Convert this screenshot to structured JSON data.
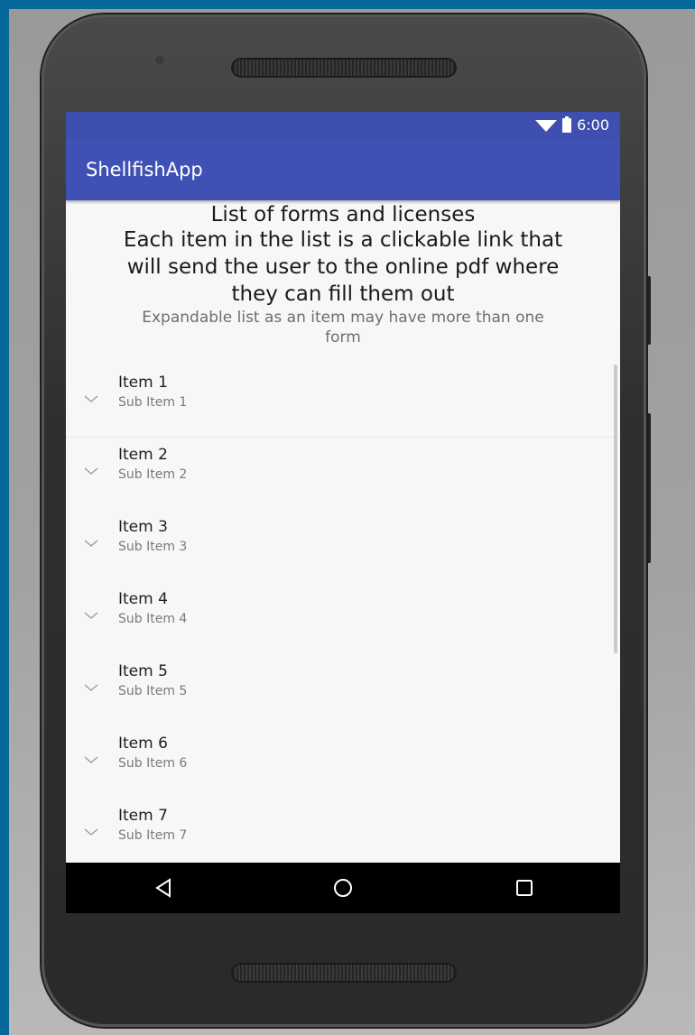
{
  "status": {
    "time": "6:00",
    "icons": [
      "wifi-icon",
      "battery-icon"
    ]
  },
  "app": {
    "title": "ShellfishApp"
  },
  "header": {
    "title": "List of forms and licenses",
    "description_line1": "Each item in the list is a clickable link that",
    "description_line2": "will send the user to the online pdf where",
    "description_line3": "they can fill them out",
    "subtitle_line1": "Expandable list as an item may have more than one",
    "subtitle_line2": "form"
  },
  "list": {
    "items": [
      {
        "title": "Item 1",
        "subtitle": "Sub Item 1"
      },
      {
        "title": "Item 2",
        "subtitle": "Sub Item 2"
      },
      {
        "title": "Item 3",
        "subtitle": "Sub Item 3"
      },
      {
        "title": "Item 4",
        "subtitle": "Sub Item 4"
      },
      {
        "title": "Item 5",
        "subtitle": "Sub Item 5"
      },
      {
        "title": "Item 6",
        "subtitle": "Sub Item 6"
      },
      {
        "title": "Item 7",
        "subtitle": "Sub Item 7"
      }
    ]
  },
  "navbar": {
    "buttons": [
      "back-icon",
      "home-icon",
      "recents-icon"
    ]
  },
  "colors": {
    "primary": "#3f51b5",
    "primary_dark": "#303f9f",
    "navbar": "#000000",
    "background": "#06689a"
  }
}
